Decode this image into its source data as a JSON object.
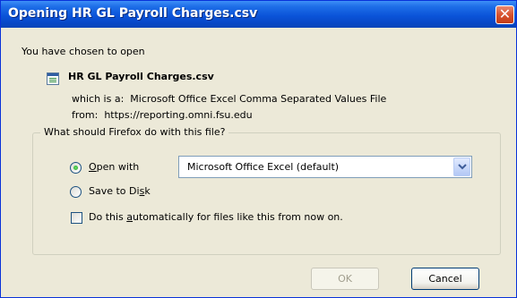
{
  "window": {
    "title": "Opening HR GL Payroll Charges.csv",
    "close_label": "✕"
  },
  "intro": "You have chosen to open",
  "file": {
    "name": "HR GL Payroll Charges.csv",
    "type_prefix": "which is a:",
    "type": "Microsoft Office Excel Comma Separated Values File",
    "from_prefix": "from:",
    "from": "https://reporting.omni.fsu.edu"
  },
  "action_group": {
    "legend": "What should Firefox do with this file?",
    "open_with": {
      "before": "",
      "key": "O",
      "after": "pen with",
      "checked": true
    },
    "application": "Microsoft Office Excel (default)",
    "save": {
      "before": "Save to Di",
      "key": "s",
      "after": "k",
      "checked": false
    },
    "auto": {
      "before": "Do this ",
      "key": "a",
      "after": "utomatically for files like this from now on.",
      "checked": false
    }
  },
  "buttons": {
    "ok": "OK",
    "cancel": "Cancel"
  },
  "icons": {
    "file": "excel-csv-file-icon",
    "close": "close-icon",
    "dropdown": "chevron-down-icon"
  }
}
